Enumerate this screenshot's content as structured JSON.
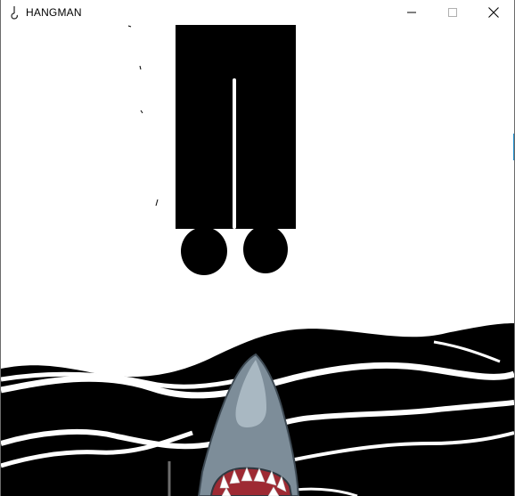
{
  "window": {
    "title": "HANGMAN",
    "app_icon": "hook-icon",
    "controls": {
      "minimize_icon": "minimize-icon",
      "maximize_icon": "maximize-icon",
      "close_icon": "close-icon"
    }
  },
  "scene": {
    "figure_parts_visible": [
      "legs",
      "feet"
    ],
    "hazard": "shark",
    "water_style": "black-and-white waves",
    "colors": {
      "ink": "#000000",
      "paper": "#ffffff",
      "shark_body": "#7d8d99",
      "shark_highlight": "#a9b8c2",
      "shark_mouth": "#9e2a33",
      "shark_teeth": "#ffffff"
    }
  }
}
